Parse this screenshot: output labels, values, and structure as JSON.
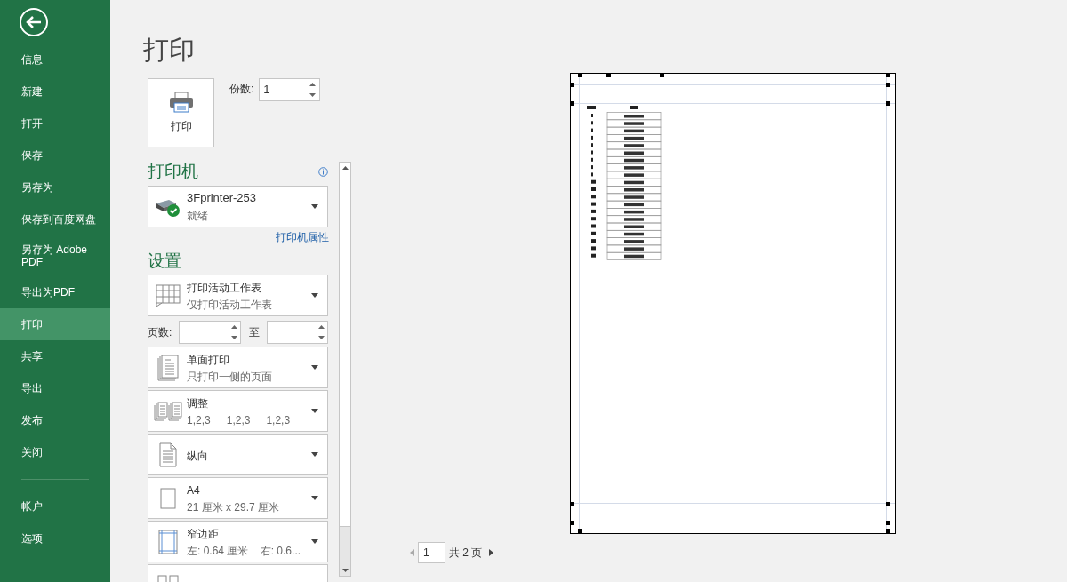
{
  "sidebar": {
    "items": [
      {
        "label": "信息",
        "selected": false
      },
      {
        "label": "新建",
        "selected": false
      },
      {
        "label": "打开",
        "selected": false
      },
      {
        "label": "保存",
        "selected": false
      },
      {
        "label": "另存为",
        "selected": false
      },
      {
        "label": "保存到百度网盘",
        "selected": false
      },
      {
        "label": "另存为 Adobe PDF",
        "selected": false
      },
      {
        "label": "导出为PDF",
        "selected": false
      },
      {
        "label": "打印",
        "selected": true
      },
      {
        "label": "共享",
        "selected": false
      },
      {
        "label": "导出",
        "selected": false
      },
      {
        "label": "发布",
        "selected": false
      },
      {
        "label": "关闭",
        "selected": false
      }
    ],
    "footer_items": [
      {
        "label": "帐户",
        "selected": false
      },
      {
        "label": "选项",
        "selected": false
      }
    ]
  },
  "title": "打印",
  "print_button": {
    "label": "打印"
  },
  "copies": {
    "label": "份数:",
    "value": "1"
  },
  "printer": {
    "heading": "打印机",
    "name": "3Fprinter-253",
    "status": "就绪",
    "properties_link": "打印机属性"
  },
  "settings": {
    "heading": "设置",
    "items": [
      {
        "kind": "dropdown",
        "title": "打印活动工作表",
        "subtitle": "仅打印活动工作表"
      },
      {
        "kind": "page_range",
        "label": "页数:",
        "to_label": "至"
      },
      {
        "kind": "dropdown",
        "title": "单面打印",
        "subtitle": "只打印一侧的页面"
      },
      {
        "kind": "dropdown",
        "title": "调整",
        "subtitle_parts": [
          "1,2,3",
          "1,2,3",
          "1,2,3"
        ]
      },
      {
        "kind": "dropdown",
        "title": "纵向"
      },
      {
        "kind": "dropdown",
        "title": "A4",
        "subtitle": "21 厘米 x 29.7 厘米"
      },
      {
        "kind": "dropdown",
        "title": "窄边距",
        "subtitle": "左: 0.64 厘米    右: 0.6..."
      },
      {
        "kind": "dropdown"
      }
    ]
  },
  "page_nav": {
    "value": "1",
    "total": "共 2 页"
  }
}
